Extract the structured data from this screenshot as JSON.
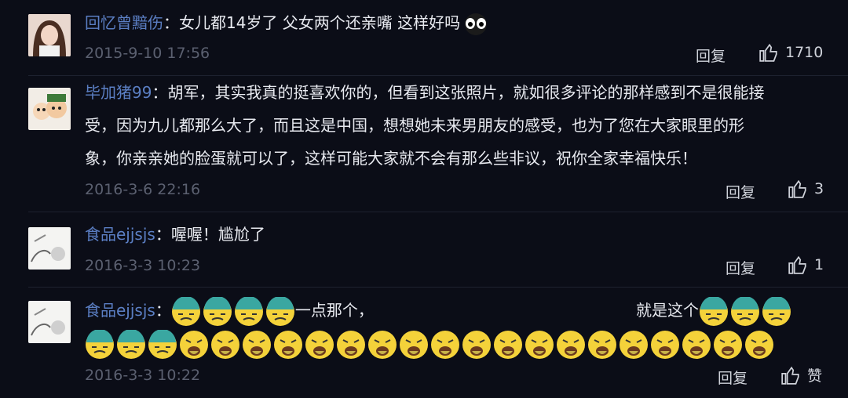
{
  "comments": [
    {
      "user": "回忆曾黯伤",
      "text": "女儿都14岁了 父女两个还亲嘴 这样好吗",
      "time": "2015-9-10 17:56",
      "reply_label": "回复",
      "likes": "1710",
      "avatar": "girl-avatar"
    },
    {
      "user": "毕加猪99",
      "text_lines": [
        "胡军，其实我真的挺喜欢你的，但看到这张照片，就如很多评论的那样感到不是很能接",
        "受，因为九儿都那么大了，而且这是中国，想想她未来男朋友的感受，也为了您在大家眼里的形",
        "象，你亲亲她的脸蛋就可以了，这样可能大家就不会有那么些非议，祝你全家幸福快乐！"
      ],
      "time": "2016-3-6 22:16",
      "reply_label": "回复",
      "likes": "3",
      "avatar": "cartoon-avatar"
    },
    {
      "user": "食品ejjsjs",
      "text": "喔喔！尴尬了",
      "time": "2016-3-3 10:23",
      "reply_label": "回复",
      "likes": "1",
      "avatar": "sketch-avatar"
    },
    {
      "user": "食品ejjsjs",
      "text_a": "一点那个，",
      "text_b": "就是这个",
      "time": "2016-3-3 10:22",
      "reply_label": "回复",
      "likes": "赞",
      "avatar": "sketch-avatar"
    }
  ],
  "colors": {
    "background": "#0b0d17",
    "username": "#5b7fc4",
    "timestamp": "#5b6070",
    "text": "#e8eaf0"
  },
  "icons": [
    "thumbs-up-icon",
    "eyes-emoji-icon",
    "sweat-emoji-icon",
    "vomit-emoji-icon"
  ]
}
